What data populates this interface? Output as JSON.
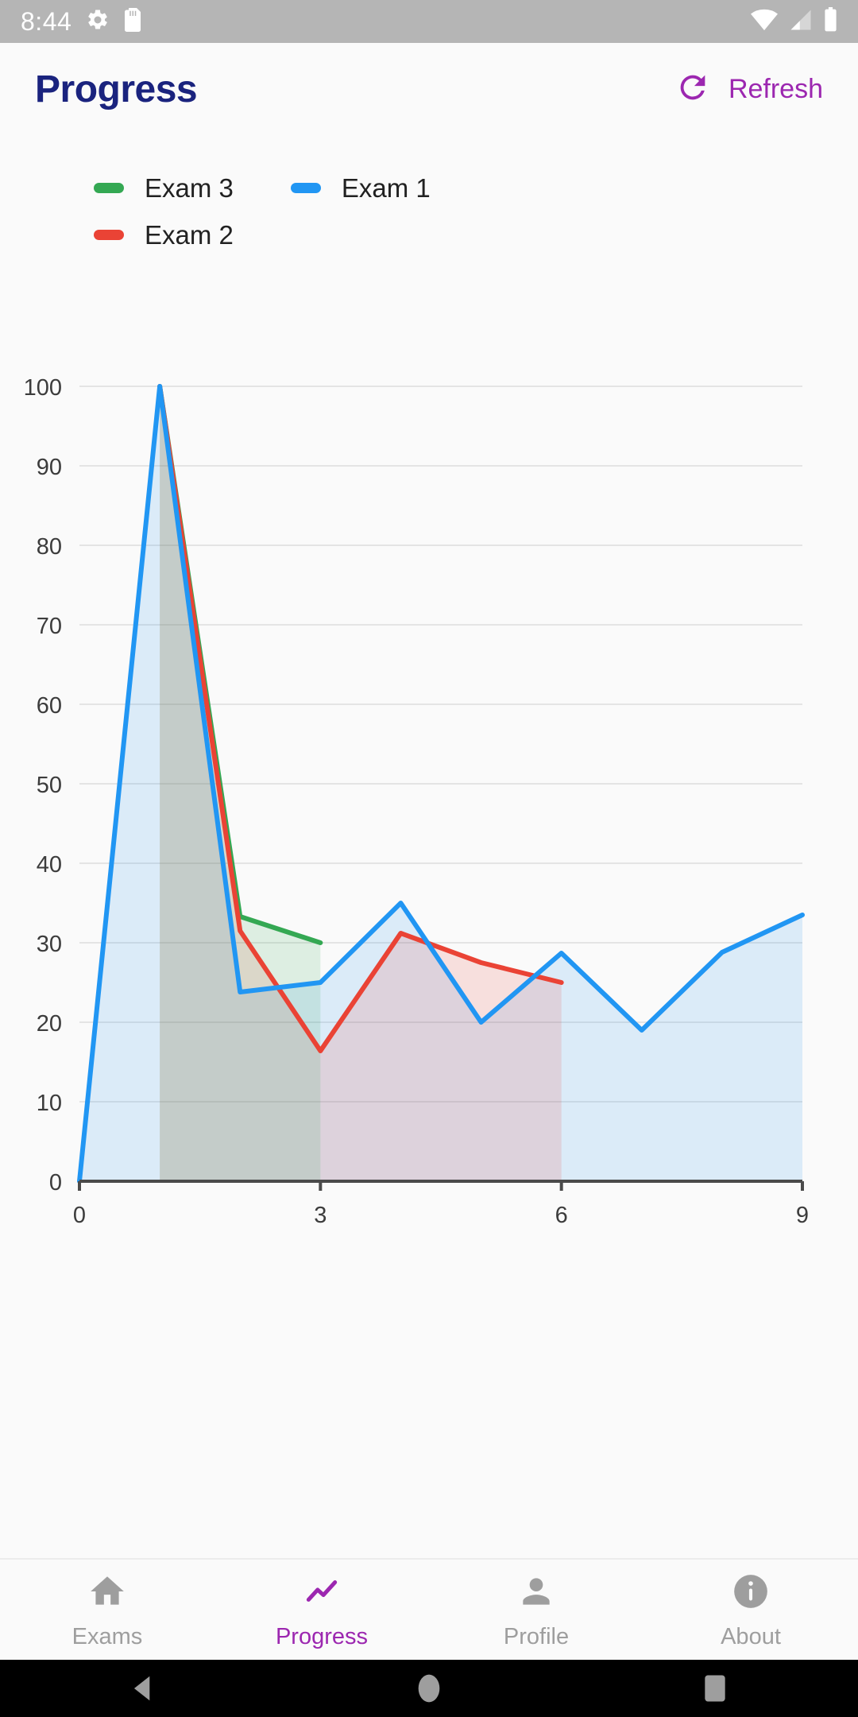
{
  "status_bar": {
    "time": "8:44",
    "icons": [
      "gear-icon",
      "sd-card-icon",
      "wifi-icon",
      "cell-signal-icon",
      "battery-icon"
    ]
  },
  "app_bar": {
    "title": "Progress",
    "refresh_label": "Refresh",
    "refresh_icon": "refresh-icon",
    "title_color": "#1A237E",
    "accent_color": "#9C27B0"
  },
  "legend": {
    "rows": [
      [
        {
          "label": "Exam 3",
          "color": "#34A853"
        },
        {
          "label": "Exam 1",
          "color": "#2196F3"
        }
      ],
      [
        {
          "label": "Exam 2",
          "color": "#EA4335"
        }
      ]
    ]
  },
  "chart_data": {
    "type": "line",
    "title": "",
    "xlabel": "",
    "ylabel": "",
    "xlim": [
      0,
      9
    ],
    "ylim": [
      0,
      100
    ],
    "xticks": [
      0,
      3,
      6,
      9
    ],
    "yticks": [
      0,
      10,
      20,
      30,
      40,
      50,
      60,
      70,
      80,
      90,
      100
    ],
    "xtick_labels": [
      "0",
      "3",
      "6",
      "9"
    ],
    "ytick_labels": [
      "0",
      "10",
      "20",
      "30",
      "40",
      "50",
      "60",
      "70",
      "80",
      "90",
      "100"
    ],
    "grid": true,
    "legend_position": "top-left",
    "area_fill": true,
    "series": [
      {
        "name": "Exam 1",
        "color": "#2196F3",
        "fill": "#D6E8F7",
        "points": [
          {
            "x": 0,
            "y": 0
          },
          {
            "x": 1,
            "y": 100
          },
          {
            "x": 2,
            "y": 23.8
          },
          {
            "x": 3,
            "y": 25.0
          },
          {
            "x": 4,
            "y": 35.0
          },
          {
            "x": 5,
            "y": 20.0
          },
          {
            "x": 6,
            "y": 28.7
          },
          {
            "x": 7,
            "y": 19.0
          },
          {
            "x": 8,
            "y": 28.8
          },
          {
            "x": 9,
            "y": 33.5
          }
        ]
      },
      {
        "name": "Exam 2",
        "color": "#EA4335",
        "fill": "#F7DCD8",
        "points": [
          {
            "x": 1,
            "y": 100
          },
          {
            "x": 2,
            "y": 31.5
          },
          {
            "x": 3,
            "y": 16.4
          },
          {
            "x": 4,
            "y": 31.2
          },
          {
            "x": 5,
            "y": 27.5
          },
          {
            "x": 6,
            "y": 25.0
          }
        ]
      },
      {
        "name": "Exam 3",
        "color": "#34A853",
        "fill": "#DCEEDC",
        "points": [
          {
            "x": 1,
            "y": 100
          },
          {
            "x": 2,
            "y": 33.3
          },
          {
            "x": 3,
            "y": 30.0
          }
        ]
      }
    ]
  },
  "bottom_nav": {
    "items": [
      {
        "label": "Exams",
        "icon": "home-icon",
        "active": false
      },
      {
        "label": "Progress",
        "icon": "trending-up-icon",
        "active": true
      },
      {
        "label": "Profile",
        "icon": "person-icon",
        "active": false
      },
      {
        "label": "About",
        "icon": "info-icon",
        "active": false
      }
    ]
  },
  "system_nav": {
    "back": "back-triangle-icon",
    "home": "home-circle-icon",
    "recents": "recents-square-icon"
  }
}
